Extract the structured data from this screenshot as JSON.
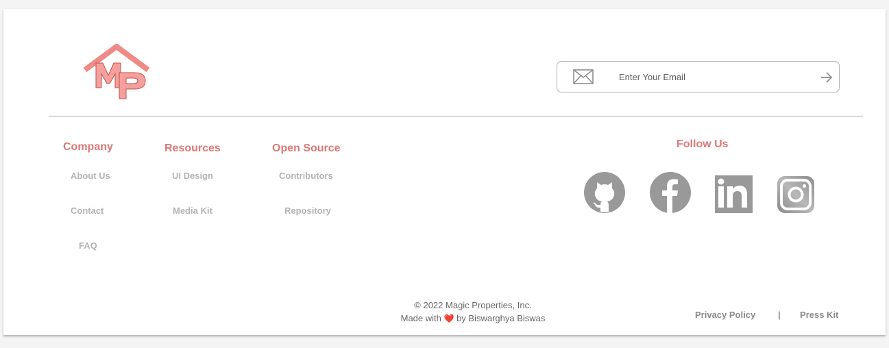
{
  "brand": {
    "logo_text": "MP"
  },
  "newsletter": {
    "placeholder": "Enter Your Email"
  },
  "columns": {
    "company": {
      "title": "Company",
      "links": [
        "About Us",
        "Contact",
        "FAQ"
      ]
    },
    "resources": {
      "title": "Resources",
      "links": [
        "UI Design",
        "Media Kit"
      ]
    },
    "open_source": {
      "title": "Open Source",
      "links": [
        "Contributors",
        "Repository"
      ]
    }
  },
  "social": {
    "title": "Follow Us",
    "icons": [
      "github-icon",
      "facebook-icon",
      "linkedin-icon",
      "instagram-icon"
    ]
  },
  "footer": {
    "copyright": "© 2022 Magic Properties, Inc.",
    "made_with": "Made with",
    "heart": "❤️",
    "by": "by Biswarghya Biswas",
    "privacy": "Privacy Policy",
    "separator": "|",
    "press_kit": "Press Kit"
  },
  "colors": {
    "accent": "#dd7777",
    "logo": "#f08a86",
    "icon_gray": "#999999",
    "link_gray": "#b3b3b3"
  }
}
